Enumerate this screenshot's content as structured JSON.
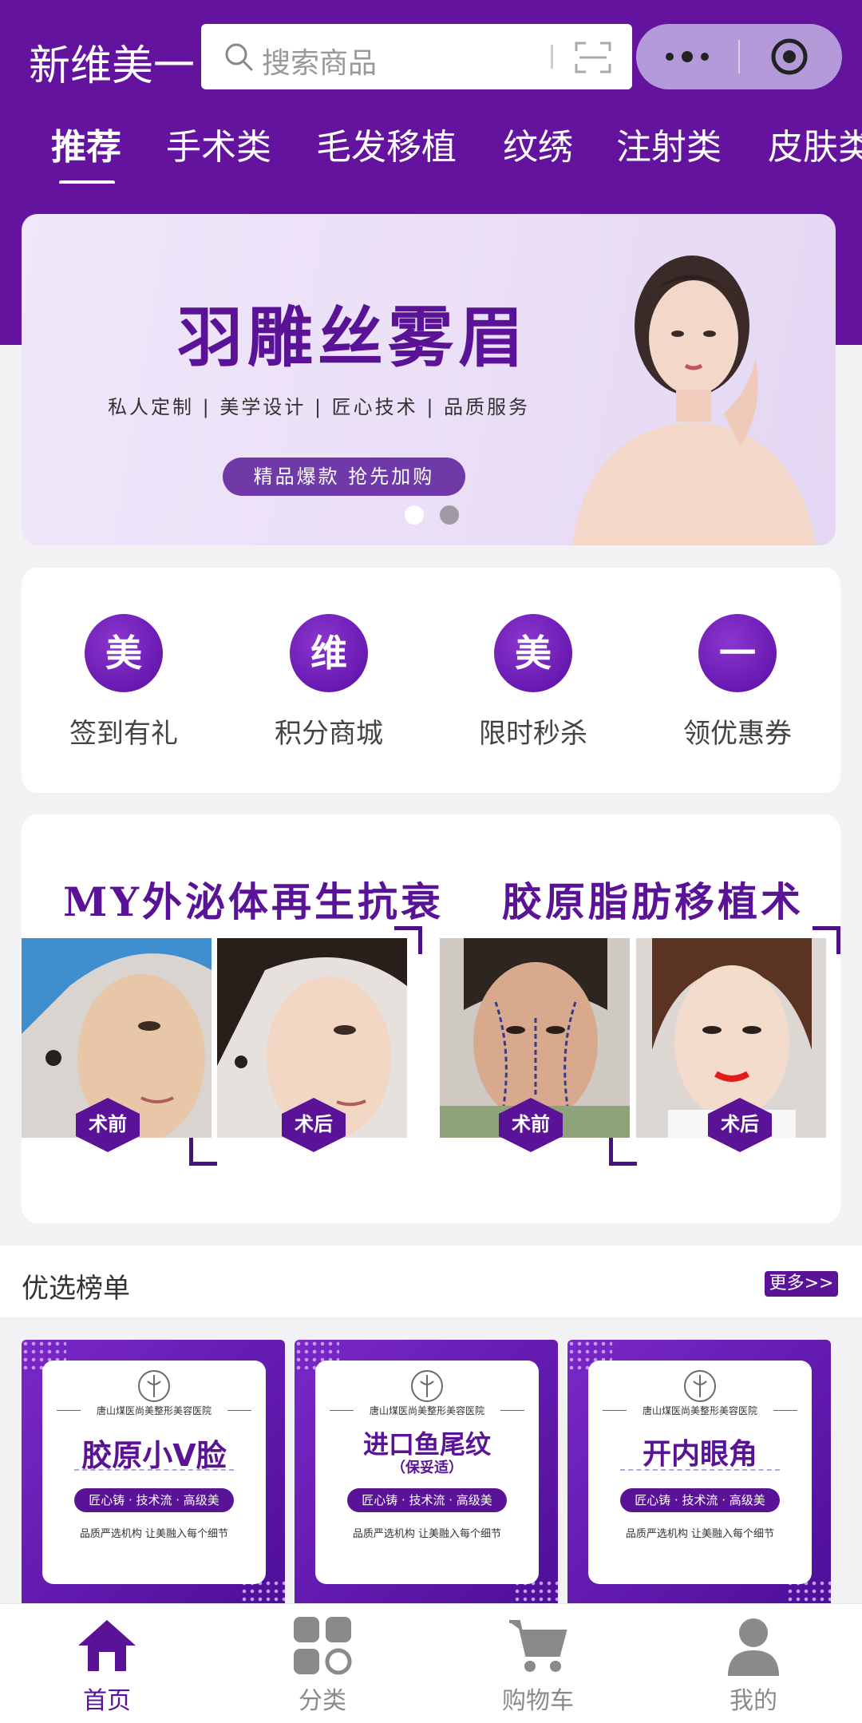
{
  "header": {
    "app_title": "新维美一",
    "search_placeholder": "搜索商品"
  },
  "tabs": [
    {
      "label": "推荐",
      "active": true
    },
    {
      "label": "手术类"
    },
    {
      "label": "毛发移植"
    },
    {
      "label": "纹绣"
    },
    {
      "label": "注射类"
    },
    {
      "label": "皮肤类"
    }
  ],
  "banner": {
    "title": "羽雕丝雾眉",
    "subtitle": "私人定制 | 美学设计 | 匠心技术 | 品质服务",
    "pill": "精品爆款 抢先加购",
    "slide_count": 2,
    "active_slide": 1
  },
  "quick_entries": [
    {
      "glyph": "美",
      "label": "签到有礼"
    },
    {
      "glyph": "维",
      "label": "积分商城"
    },
    {
      "glyph": "美",
      "label": "限时秒杀"
    },
    {
      "glyph": "一",
      "label": "领优惠券"
    }
  ],
  "showcase": [
    {
      "title": "MY外泌体再生抗衰",
      "before": "术前",
      "after": "术后"
    },
    {
      "title": "胶原脂肪移植术",
      "before": "术前",
      "after": "术后"
    }
  ],
  "ranking": {
    "title": "优选榜单",
    "more": "更多>>",
    "cards": [
      {
        "org": "唐山煤医尚美整形美容医院",
        "name": "胶原小V脸",
        "sub": "",
        "slogan": "匠心铸 · 技术流 · 高级美",
        "note": "品质严选机构 让美融入每个细节"
      },
      {
        "org": "唐山煤医尚美整形美容医院",
        "name": "进口鱼尾纹",
        "sub": "（保妥适）",
        "slogan": "匠心铸 · 技术流 · 高级美",
        "note": "品质严选机构 让美融入每个细节"
      },
      {
        "org": "唐山煤医尚美整形美容医院",
        "name": "开内眼角",
        "sub": "",
        "slogan": "匠心铸 · 技术流 · 高级美",
        "note": "品质严选机构 让美融入每个细节"
      }
    ]
  },
  "bottom_nav": [
    {
      "label": "首页",
      "icon": "home-icon",
      "active": true
    },
    {
      "label": "分类",
      "icon": "category-icon"
    },
    {
      "label": "购物车",
      "icon": "cart-icon"
    },
    {
      "label": "我的",
      "icon": "profile-icon"
    }
  ],
  "colors": {
    "brand_purple": "#63139e",
    "capsule": "#b49ad8",
    "nav_active": "#5a1396",
    "nav_inactive": "#8a8a8a"
  }
}
